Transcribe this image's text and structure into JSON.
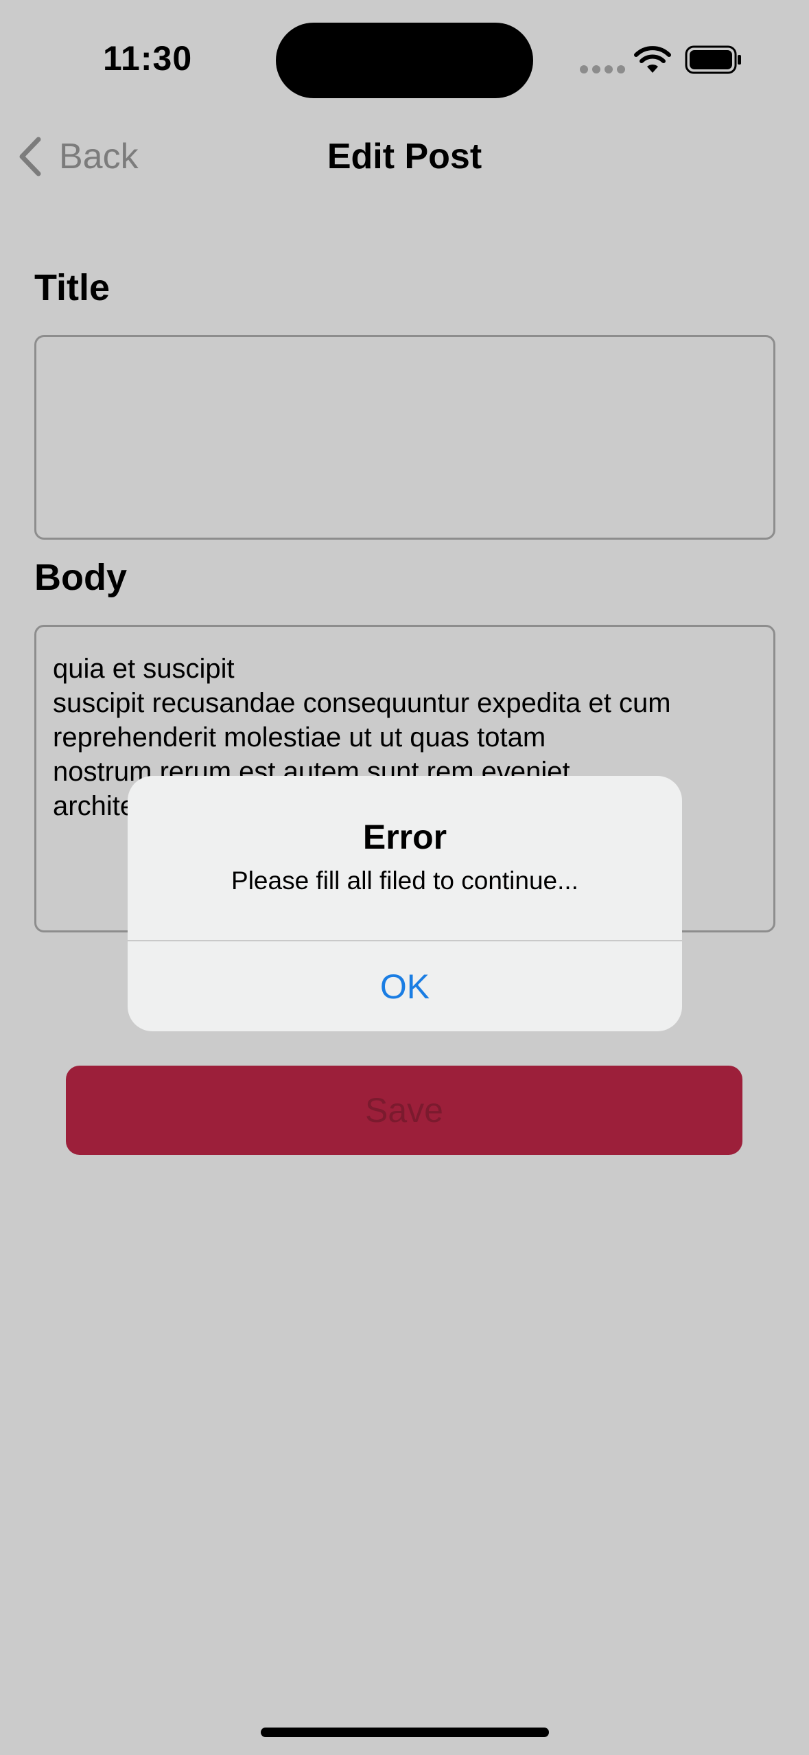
{
  "status_bar": {
    "time": "11:30"
  },
  "nav": {
    "back_label": "Back",
    "title": "Edit Post"
  },
  "form": {
    "title_label": "Title",
    "title_value": "",
    "body_label": "Body",
    "body_lines": [
      "quia et suscipit",
      "suscipit recusandae consequuntur expedita et cum",
      "reprehenderit molestiae ut ut quas totam",
      "nostrum rerum est autem sunt rem eveniet",
      "architecto"
    ]
  },
  "save_button": {
    "label": "Save"
  },
  "alert": {
    "title": "Error",
    "message": "Please fill all filed to continue...",
    "ok_label": "OK"
  },
  "colors": {
    "background": "#cbcbcb",
    "accent_blue": "#1a7de3",
    "save_button": "#9c1f3a",
    "alert_background": "#eff0f0"
  },
  "icons": [
    "chevron-left-icon",
    "wifi-icon",
    "battery-icon",
    "cellular-signal-icon"
  ]
}
